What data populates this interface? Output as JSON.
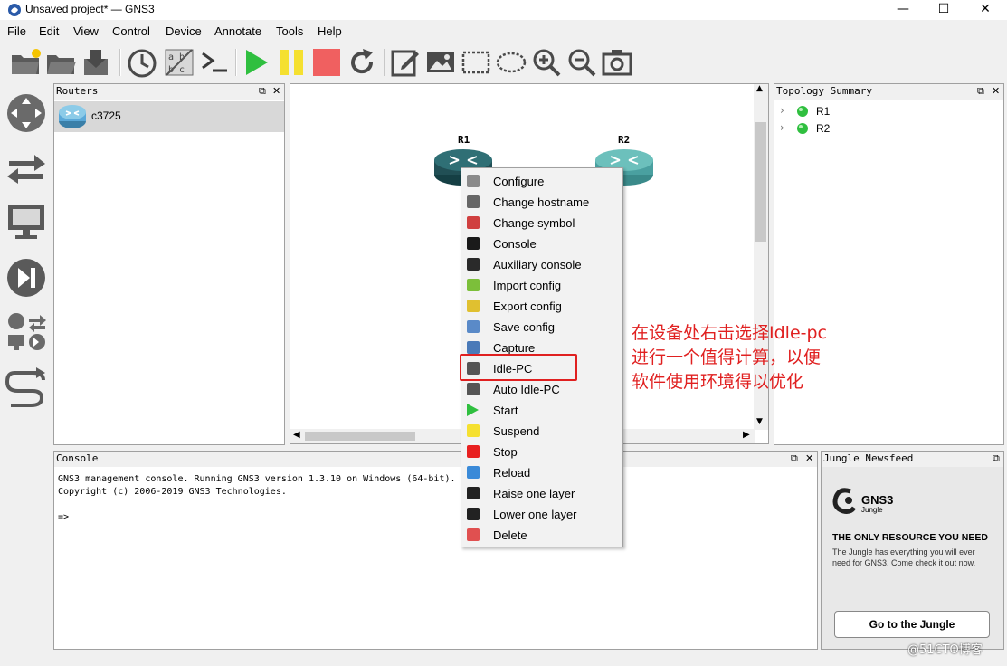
{
  "window": {
    "title": "Unsaved project* — GNS3",
    "minimize": "—",
    "maximize": "☐",
    "close": "✕"
  },
  "menubar": [
    "File",
    "Edit",
    "View",
    "Control",
    "Device",
    "Annotate",
    "Tools",
    "Help"
  ],
  "toolbar": {
    "icons": [
      "new-project-icon",
      "open-project-icon",
      "save-project-icon",
      "snapshot-icon",
      "show-interface-labels-icon",
      "console-all-icon",
      "start-all-icon",
      "suspend-all-icon",
      "stop-all-icon",
      "reload-all-icon",
      "add-note-icon",
      "insert-picture-icon",
      "draw-rectangle-icon",
      "draw-ellipse-icon",
      "zoom-in-icon",
      "zoom-out-icon",
      "screenshot-icon"
    ]
  },
  "device_types": [
    "router",
    "switch",
    "end-device",
    "security-device",
    "all-devices",
    "add-link"
  ],
  "routers_panel": {
    "title": "Routers",
    "items": [
      {
        "label": "c3725"
      }
    ]
  },
  "topology": {
    "nodes": [
      {
        "label": "R1"
      },
      {
        "label": "R2"
      }
    ]
  },
  "context_menu": {
    "items": [
      {
        "label": "Configure",
        "icon": "configure-icon"
      },
      {
        "label": "Change hostname",
        "icon": "hostname-icon"
      },
      {
        "label": "Change symbol",
        "icon": "symbol-icon"
      },
      {
        "label": "Console",
        "icon": "console-icon"
      },
      {
        "label": "Auxiliary console",
        "icon": "aux-console-icon"
      },
      {
        "label": "Import config",
        "icon": "import-icon"
      },
      {
        "label": "Export config",
        "icon": "export-icon"
      },
      {
        "label": "Save config",
        "icon": "save-config-icon"
      },
      {
        "label": "Capture",
        "icon": "capture-icon"
      },
      {
        "label": "Idle-PC",
        "icon": "idle-pc-icon"
      },
      {
        "label": "Auto Idle-PC",
        "icon": "auto-idle-pc-icon"
      },
      {
        "label": "Start",
        "icon": "start-icon"
      },
      {
        "label": "Suspend",
        "icon": "suspend-icon"
      },
      {
        "label": "Stop",
        "icon": "stop-icon"
      },
      {
        "label": "Reload",
        "icon": "reload-icon"
      },
      {
        "label": "Raise one layer",
        "icon": "raise-layer-icon"
      },
      {
        "label": "Lower one layer",
        "icon": "lower-layer-icon"
      },
      {
        "label": "Delete",
        "icon": "delete-icon"
      }
    ]
  },
  "annotation": {
    "lines": [
      "在设备处右击选择Idle-pc",
      "进行一个值得计算，以便",
      "软件使用环境得以优化"
    ]
  },
  "topology_summary": {
    "title": "Topology Summary",
    "nodes": [
      {
        "label": "R1",
        "status": "started"
      },
      {
        "label": "R2",
        "status": "started"
      }
    ]
  },
  "console": {
    "title": "Console",
    "lines": [
      "GNS3 management console. Running GNS3 version 1.3.10 on Windows (64-bit).",
      "Copyright (c) 2006-2019 GNS3 Technologies.",
      "",
      "=>"
    ]
  },
  "jungle": {
    "title": "Jungle Newsfeed",
    "logo_text": "GNS3",
    "logo_sub": "Jungle",
    "headline": "THE ONLY RESOURCE YOU NEED",
    "body": "The Jungle has everything you will ever need for GNS3. Come check it out now.",
    "button": "Go to the Jungle"
  },
  "watermark": "@51CTO博客",
  "colors": {
    "accent_red": "#e02020",
    "status_green": "#2fbf3f",
    "router_teal": "#2f6f75"
  }
}
